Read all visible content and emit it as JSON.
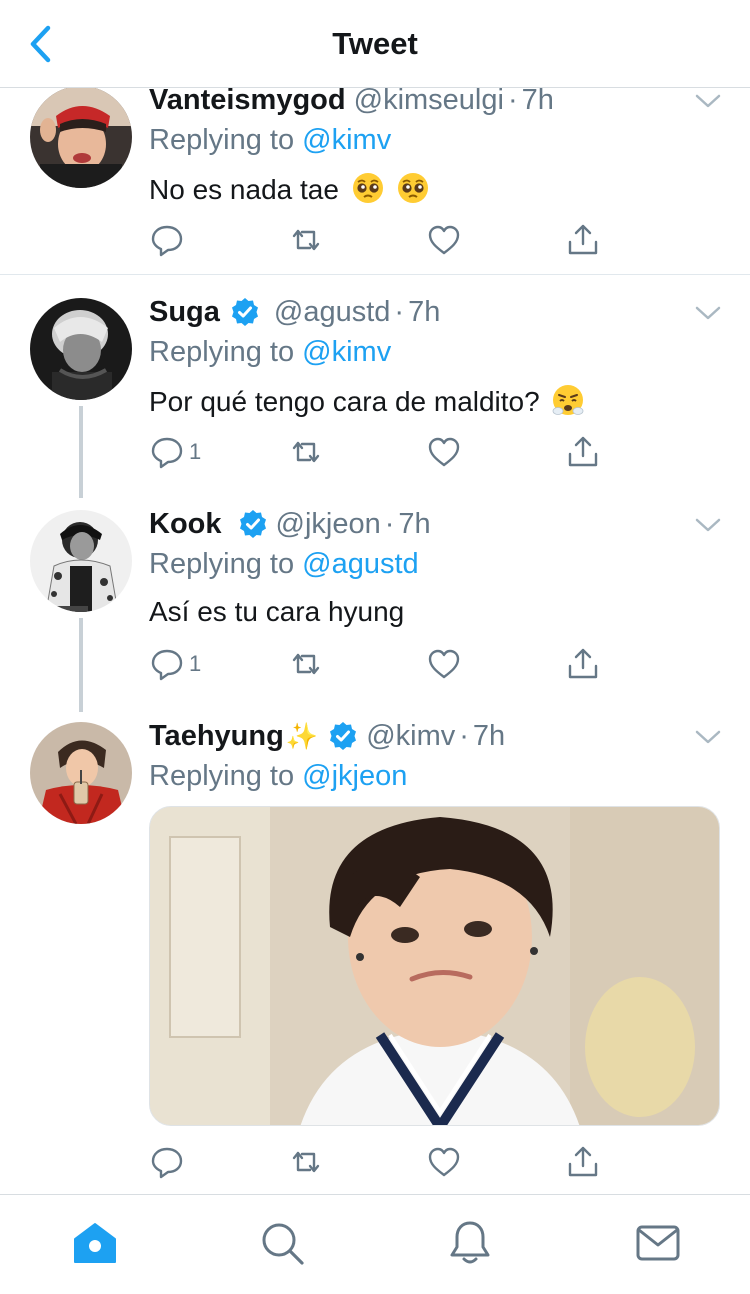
{
  "header": {
    "title": "Tweet"
  },
  "colors": {
    "accent": "#1da1f2",
    "secondary_text": "#657786",
    "primary_text": "#14171a"
  },
  "tweets": [
    {
      "name": "Vanteismygod",
      "handle": "@kimseulgi",
      "time": "7h",
      "verified": false,
      "replying_label": "Replying to",
      "replying_to": "@kimv",
      "text": "No es nada tae",
      "emoji": [
        "pleading-face",
        "pleading-face"
      ],
      "reply_count": ""
    },
    {
      "name": "Suga",
      "handle": "@agustd",
      "time": "7h",
      "verified": true,
      "replying_label": "Replying to",
      "replying_to": "@kimv",
      "text": "Por qué tengo cara de maldito?",
      "emoji": [
        "face-with-steam"
      ],
      "reply_count": "1"
    },
    {
      "name": "Kook",
      "handle": "@jkjeon",
      "time": "7h",
      "verified": true,
      "replying_label": "Replying to",
      "replying_to": "@agustd",
      "text": "Así es tu cara hyung",
      "emoji": [],
      "reply_count": "1"
    },
    {
      "name": "Taehyung",
      "name_emoji": "✨",
      "handle": "@kimv",
      "time": "7h",
      "verified": true,
      "replying_label": "Replying to",
      "replying_to": "@jkjeon",
      "text": "",
      "media": "photo",
      "reply_count": ""
    }
  ],
  "tabbar": {
    "items": [
      "home-icon",
      "search-icon",
      "notifications-icon",
      "messages-icon"
    ],
    "active": "home-icon"
  }
}
